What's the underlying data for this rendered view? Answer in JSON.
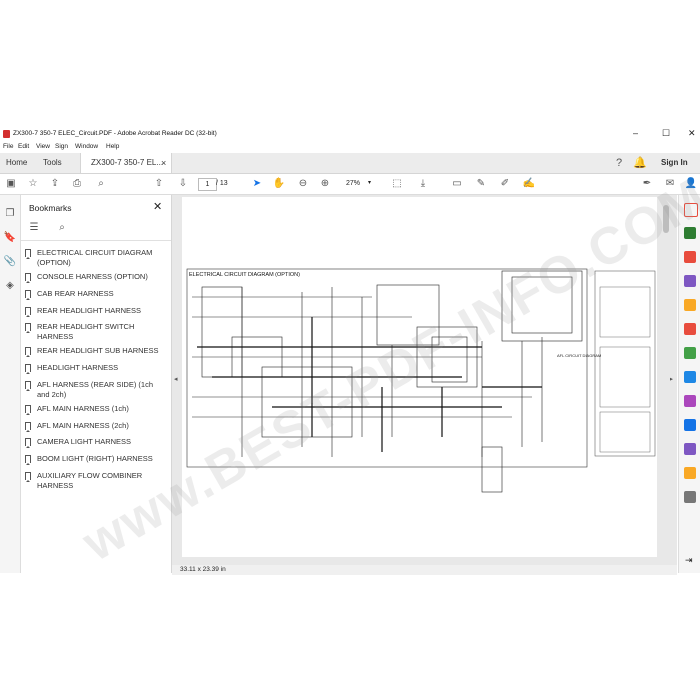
{
  "window": {
    "title": "ZX300-7 350-7 ELEC_Circuit.PDF - Adobe Acrobat Reader DC (32-bit)",
    "minimize": "–",
    "maximize": "☐",
    "close": "✕"
  },
  "menu": [
    "File",
    "Edit",
    "View",
    "Sign",
    "Window",
    "Help"
  ],
  "tabs": {
    "home": "Home",
    "tools": "Tools",
    "document": "ZX300-7 350-7 EL...",
    "close": "×",
    "sign_in": "Sign In"
  },
  "toolbar": {
    "page_current": "1",
    "page_total": "/ 13",
    "zoom": "27%"
  },
  "bookmarks": {
    "title": "Bookmarks",
    "items": [
      "ELECTRICAL CIRCUIT DIAGRAM (OPTION)",
      "CONSOLE HARNESS (OPTION)",
      "CAB REAR HARNESS",
      "REAR HEADLIGHT HARNESS",
      "REAR HEADLIGHT SWITCH HARNESS",
      "REAR HEADLIGHT SUB HARNESS",
      "HEADLIGHT HARNESS",
      "AFL HARNESS (REAR SIDE) (1ch and 2ch)",
      "AFL MAIN HARNESS (1ch)",
      "AFL MAIN HARNESS (2ch)",
      "CAMERA LIGHT HARNESS",
      "BOOM LIGHT (RIGHT) HARNESS",
      "AUXILIARY FLOW COMBINER HARNESS"
    ]
  },
  "document": {
    "diagram_title": "ELECTRICAL CIRCUIT DIAGRAM (OPTION)",
    "inset_label": "AFL CIRCUIT DIAGRAM",
    "page_size": "33.11 x 23.39 in"
  },
  "watermark": "www.BEST-PDF-INFO.COM",
  "colors": {
    "accent": "#1473e6",
    "pdf_red": "#d32f2f"
  }
}
